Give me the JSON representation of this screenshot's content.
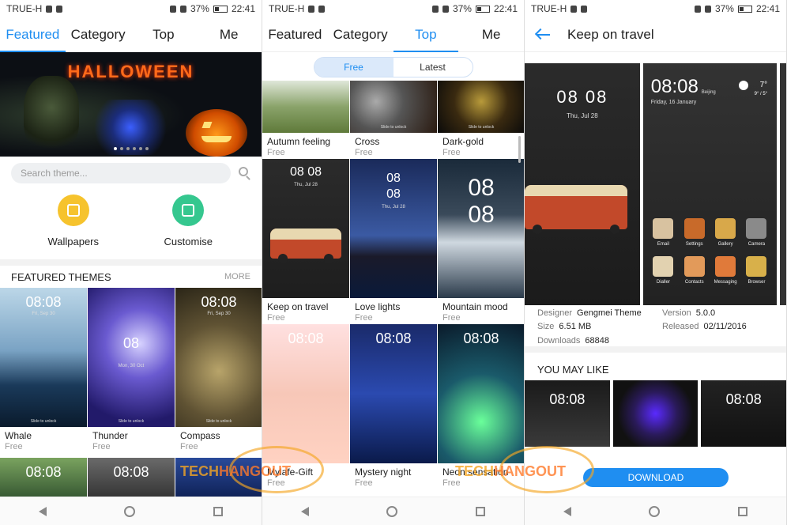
{
  "status": {
    "carrier": "TRUE-H",
    "battery": "37%",
    "time": "22:41"
  },
  "panel1": {
    "tabs": [
      "Featured",
      "Category",
      "Top",
      "Me"
    ],
    "banner_title": "HALLOWEEN",
    "search_placeholder": "Search theme...",
    "shortcuts": [
      "Wallpapers",
      "Customise"
    ],
    "section_title": "FEATURED THEMES",
    "section_more": "MORE",
    "themes": [
      {
        "name": "Whale",
        "price": "Free",
        "clock": "08:08",
        "date": "Fri, Sep 30",
        "unlock": "Slide to unlock"
      },
      {
        "name": "Thunder",
        "price": "Free",
        "clock": "08",
        "date": "Mon, 30 Oct",
        "unlock": "Slide to unlock"
      },
      {
        "name": "Compass",
        "price": "Free",
        "clock": "08:08",
        "date": "Fri, Sep 30",
        "unlock": "Slide to unlock"
      }
    ],
    "second_row_clocks": [
      "08:08",
      "08:08",
      ""
    ]
  },
  "panel2": {
    "tabs": [
      "Featured",
      "Category",
      "Top",
      "Me"
    ],
    "segments": [
      "Free",
      "Latest"
    ],
    "themes": [
      {
        "name": "Autumn feeling",
        "price": "Free"
      },
      {
        "name": "Cross",
        "price": "Free",
        "unlock": "Slide to unlock"
      },
      {
        "name": "Dark-gold",
        "price": "Free",
        "unlock": "Slide to unlock"
      },
      {
        "name": "Keep on travel",
        "price": "Free",
        "clock": "08 08",
        "date": "Thu, Jul 28"
      },
      {
        "name": "Love lights",
        "price": "Free",
        "clock": "08",
        "clock2": "08",
        "date": "Thu, Jul 28"
      },
      {
        "name": "Mountain mood",
        "price": "Free",
        "clock": "08",
        "clock2": "08"
      },
      {
        "name": "Mylafe-Gift",
        "price": "Free",
        "clock": "08:08"
      },
      {
        "name": "Mystery night",
        "price": "Free",
        "clock": "08:08"
      },
      {
        "name": "Neon sensation",
        "price": "Free",
        "clock": "08:08"
      }
    ]
  },
  "panel3": {
    "title": "Keep on travel",
    "preview1": {
      "clock": "08 08",
      "date": "Thu, Jul 28"
    },
    "preview2": {
      "clock": "08:08",
      "date": "Friday, 16 January",
      "city": "Beijing",
      "temp": "7°",
      "range": "9° / 5°"
    },
    "apps": [
      "Email",
      "Settings",
      "Gallery",
      "Camera",
      "Dialler",
      "Contacts",
      "Messaging",
      "Browser"
    ],
    "meta": {
      "designer_label": "Designer",
      "designer": "Gengmei Theme",
      "version_label": "Version",
      "version": "5.0.0",
      "size_label": "Size",
      "size": "6.51 MB",
      "released_label": "Released",
      "released": "02/11/2016",
      "downloads_label": "Downloads",
      "downloads": "68848"
    },
    "you_may_like": "YOU MAY LIKE",
    "like_clocks": [
      "08:08",
      "",
      "08:08"
    ],
    "download": "DOWNLOAD"
  },
  "watermark": {
    "part1": "TECH",
    "part2": "HANGOUT"
  },
  "colors": {
    "accent": "#1f8ef1",
    "wallpapers": "#f6c32d",
    "customise": "#35c78f",
    "watermark": "#f5a623"
  }
}
